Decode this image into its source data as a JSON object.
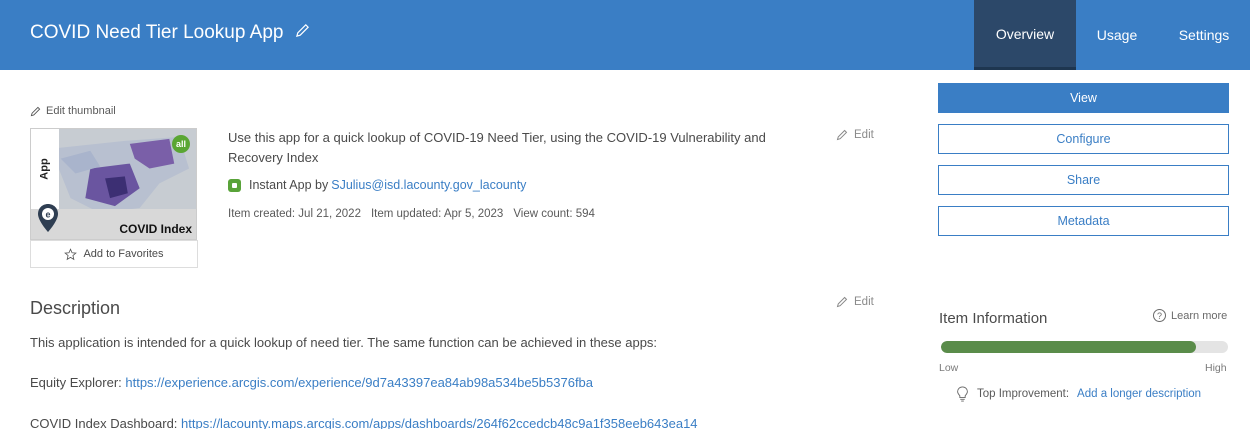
{
  "header": {
    "title": "COVID Need Tier Lookup App",
    "tabs": [
      {
        "label": "Overview",
        "active": true
      },
      {
        "label": "Usage",
        "active": false
      },
      {
        "label": "Settings",
        "active": false
      }
    ],
    "color": "#3a7ec5"
  },
  "thumbnail": {
    "edit_label": "Edit thumbnail",
    "side_label": "App",
    "badge": "all",
    "caption": "COVID Index",
    "favorites_label": "Add to Favorites"
  },
  "summary": {
    "text": "Use this app for a quick lookup of COVID-19 Need Tier, using the COVID-19 Vulnerability and Recovery Index",
    "edit_label": "Edit",
    "type_prefix": "Instant App by ",
    "owner": "SJulius@isd.lacounty.gov_lacounty",
    "created": "Item created: Jul 21, 2022",
    "updated": "Item updated: Apr 5, 2023",
    "views": "View count: 594"
  },
  "description": {
    "title": "Description",
    "edit_label": "Edit",
    "intro": "This application is intended for a quick lookup of need tier. The same function can be achieved in these apps:",
    "links": [
      {
        "label": "Equity Explorer: ",
        "url": "https://experience.arcgis.com/experience/9d7a43397ea84ab98a534be5b5376fba"
      },
      {
        "label": "COVID Index Dashboard: ",
        "url": "https://lacounty.maps.arcgis.com/apps/dashboards/264f62ccedcb48c9a1f358eeb643ea14"
      }
    ]
  },
  "actions": {
    "view": "View",
    "configure": "Configure",
    "share": "Share",
    "metadata": "Metadata"
  },
  "item_info": {
    "title": "Item Information",
    "learn_more": "Learn more",
    "progress": 0.89,
    "low": "Low",
    "high": "High",
    "improvement_label": "Top Improvement:",
    "improvement_link": "Add a longer description",
    "bar_color": "#5a8c4a"
  }
}
